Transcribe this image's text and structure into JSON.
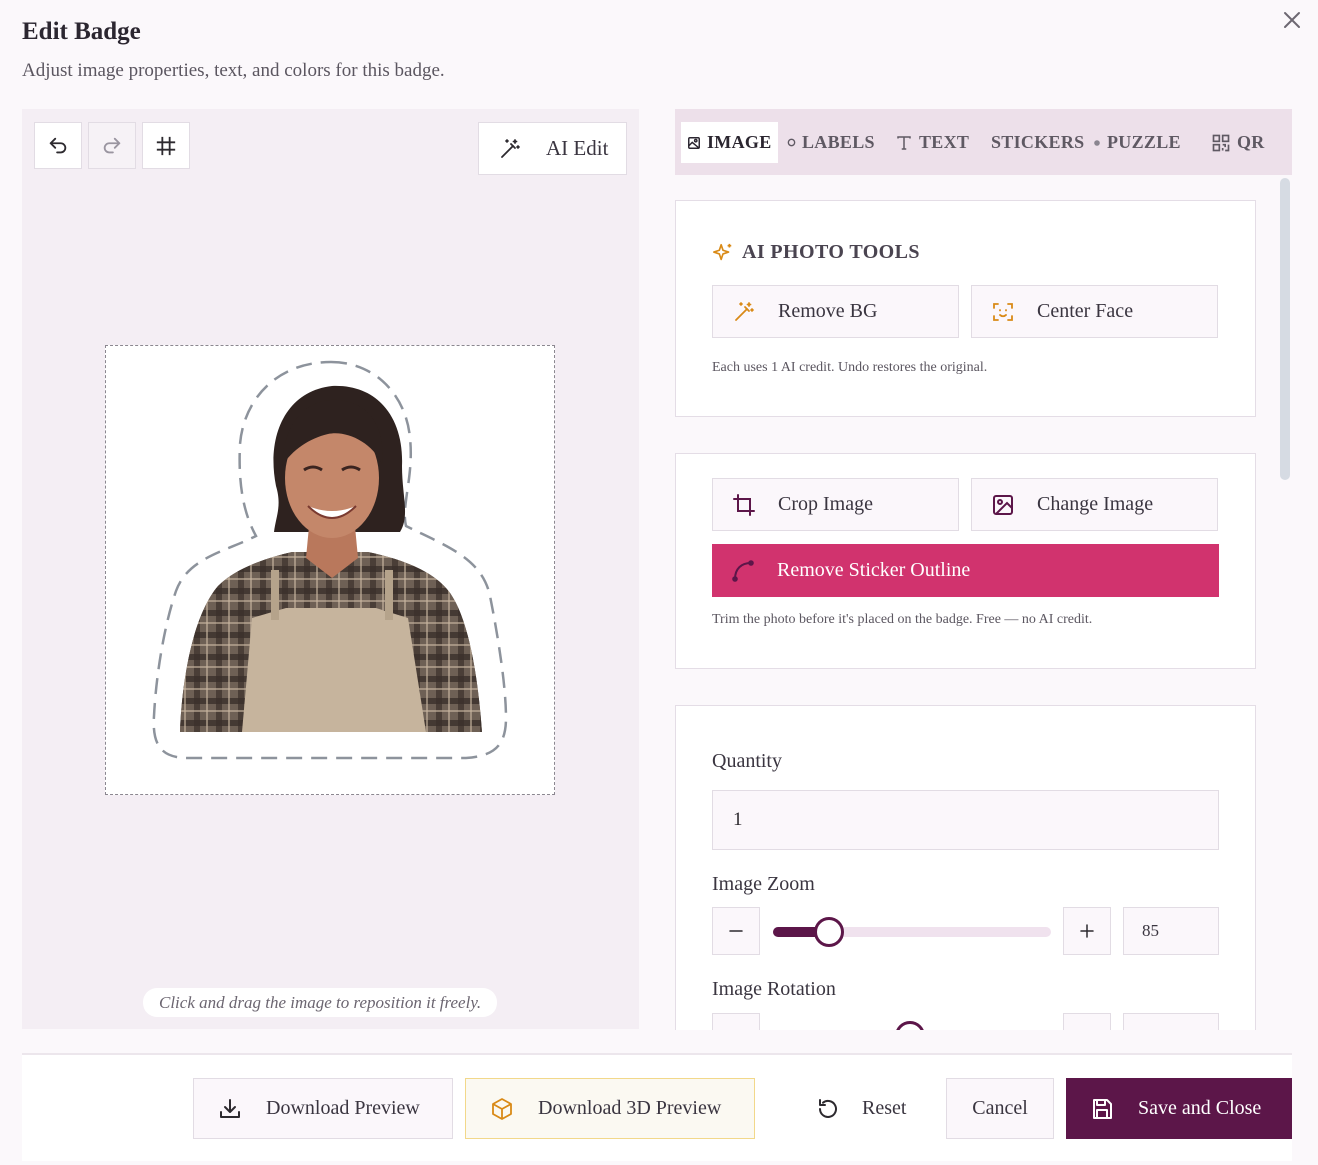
{
  "dialog": {
    "title": "Edit Badge",
    "subtitle": "Adjust image properties, text, and colors for this badge."
  },
  "canvas": {
    "ai_edit_label": "AI Edit",
    "drag_hint": "Click and drag the image to reposition it freely."
  },
  "tabs": [
    {
      "label": "IMAGE",
      "icon": "image-icon",
      "active": true
    },
    {
      "label": "LABELS",
      "icon": "tag-icon",
      "active": false
    },
    {
      "label": "TEXT",
      "icon": "text-icon",
      "active": false
    },
    {
      "label": "STICKERS",
      "icon": "",
      "active": false
    },
    {
      "label": "PUZZLE",
      "icon": "puzzle-icon",
      "active": false
    },
    {
      "label": "QR",
      "icon": "qr-icon",
      "active": false
    }
  ],
  "ai_tools": {
    "heading": "AI PHOTO TOOLS",
    "remove_bg_label": "Remove BG",
    "center_face_label": "Center Face",
    "note": "Each uses 1 AI credit. Undo restores the original."
  },
  "image_tools": {
    "crop_label": "Crop Image",
    "change_label": "Change Image",
    "outline_label": "Remove Sticker Outline",
    "note": "Trim the photo before it's placed on the badge. Free — no AI credit."
  },
  "settings": {
    "quantity_label": "Quantity",
    "quantity_value": "1",
    "zoom_label": "Image Zoom",
    "zoom_value": "85",
    "zoom_fraction": 0.2,
    "rotation_label": "Image Rotation"
  },
  "footer": {
    "download_preview_label": "Download Preview",
    "download_3d_label": "Download 3D Preview",
    "reset_label": "Reset",
    "cancel_label": "Cancel",
    "save_label": "Save and Close"
  },
  "colors": {
    "accent": "#5c1649",
    "primary_action": "#d1336e",
    "ai_icon": "#d98a17"
  }
}
